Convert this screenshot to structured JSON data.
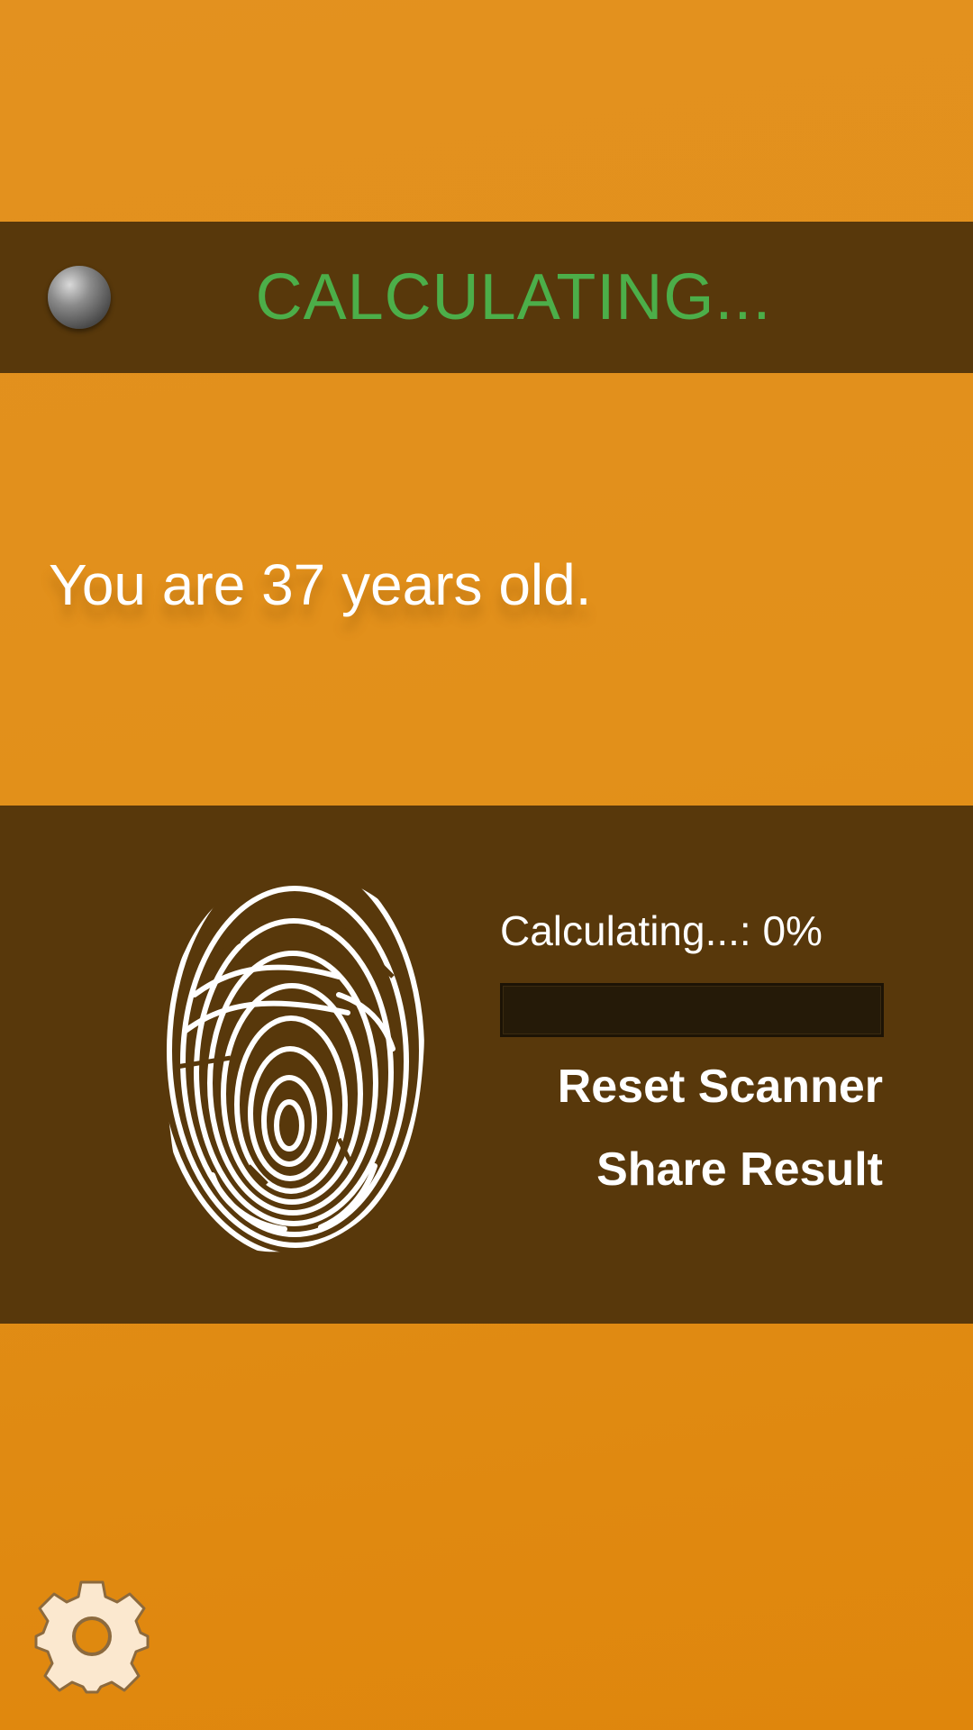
{
  "status": {
    "title": "CALCULATING...",
    "indicator_icon": "status-light-icon",
    "title_color": "#4cae49"
  },
  "result": {
    "text": "You are 37 years old."
  },
  "scanner": {
    "fingerprint_icon": "fingerprint-icon",
    "progress_label": "Calculating...: 0%",
    "progress_fraction": 0,
    "reset_label": "Reset Scanner",
    "share_label": "Share Result"
  },
  "settings": {
    "icon": "gear-icon"
  },
  "colors": {
    "background": "#e2901a",
    "panel": "#58380b",
    "accent_green": "#4cae49",
    "text": "#ffffff"
  }
}
